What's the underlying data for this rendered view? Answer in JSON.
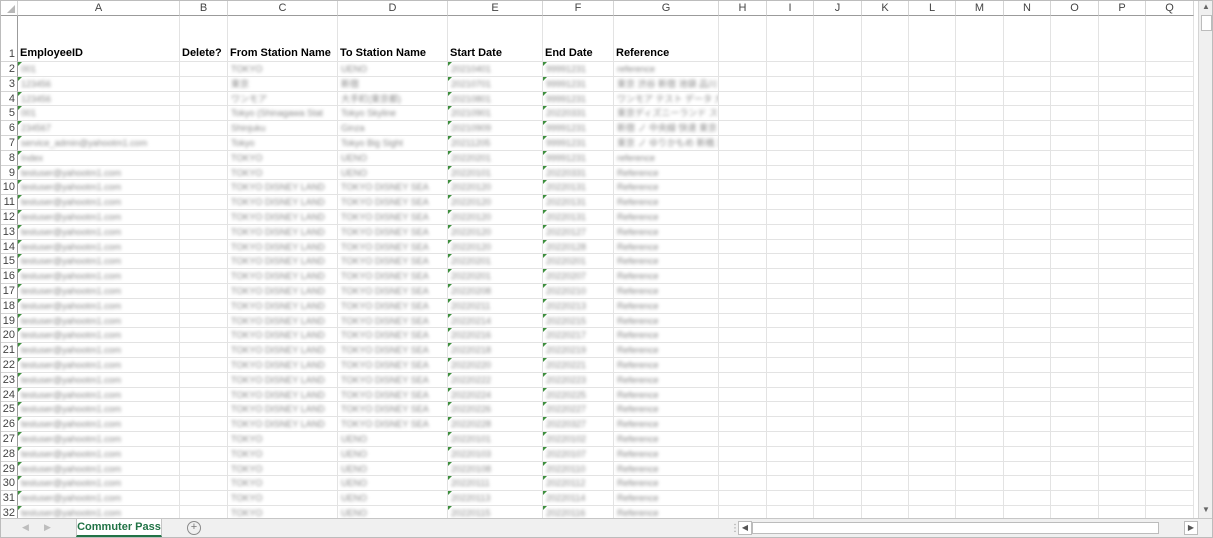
{
  "sheet": {
    "columns": [
      "A",
      "B",
      "C",
      "D",
      "E",
      "F",
      "G",
      "H",
      "I",
      "J",
      "K",
      "L",
      "M",
      "N",
      "O",
      "P",
      "Q"
    ],
    "header_row_number": "1",
    "headers": {
      "A": "EmployeeID",
      "B": "Delete?",
      "C": "From Station Name",
      "D": "To Station Name",
      "E": "Start Date",
      "F": "End Date",
      "G": "Reference"
    },
    "rows": [
      {
        "n": "2",
        "A": "001",
        "C": "TOKYO",
        "D": "UENO",
        "E": "20210401",
        "F": "99991231",
        "G": "reference"
      },
      {
        "n": "3",
        "A": "123456",
        "C": "東京",
        "D": "新宿",
        "E": "20210701",
        "F": "99991231",
        "G": "東京 渋谷 新宿 池袋 品川 目黒 恵比寿 五反田 大崎 浜松町 田町 高輪ゲートウェイ"
      },
      {
        "n": "4",
        "A": "123456",
        "C": "ワンモア",
        "D": "大手町(東京都)",
        "E": "20210801",
        "F": "99991231",
        "G": "ワンモア テスト データ 大手町 東京都 千代田区 丸の内 一丁目"
      },
      {
        "n": "5",
        "A": "001",
        "C": "Tokyo (Shinagawa Stat",
        "D": "Tokyo Skyline",
        "E": "20210901",
        "F": "20220331",
        "G": "東京ディズニーランド ステーション ディズニーシー ステーション リゾートゲートウェイ"
      },
      {
        "n": "6",
        "A": "234567",
        "C": "Shinjuku",
        "D": "Ginza",
        "E": "20210909",
        "F": "99991231",
        "G": "新宿 ノ  中央線 快速 東京 神田 御茶ノ水 四ツ谷 銀座線"
      },
      {
        "n": "7",
        "A": "service_admin@yahootm1.com",
        "C": "Tokyo",
        "D": "Tokyo Big Sight",
        "E": "20211205",
        "F": "99991231",
        "G": "東京 ノ  ゆりかもめ 新橋 汐留 竹芝 日の出 芝浦ふ頭 お台場海浜公園 台場 東京ビッグサイト"
      },
      {
        "n": "8",
        "A": "Index",
        "C": "TOKYO",
        "D": "UENO",
        "E": "20220201",
        "F": "99991231",
        "G": "reference"
      },
      {
        "n": "9",
        "A": "testuser@yahootm1.com",
        "C": "TOKYO",
        "D": "UENO",
        "E": "20220101",
        "F": "20220331",
        "G": "Reference"
      },
      {
        "n": "10",
        "A": "testuser@yahootm1.com",
        "C": "TOKYO DISNEY LAND",
        "D": "TOKYO DISNEY SEA",
        "E": "20220120",
        "F": "20220131",
        "G": "Reference"
      },
      {
        "n": "11",
        "A": "testuser@yahootm1.com",
        "C": "TOKYO DISNEY LAND",
        "D": "TOKYO DISNEY SEA",
        "E": "20220120",
        "F": "20220131",
        "G": "Reference"
      },
      {
        "n": "12",
        "A": "testuser@yahootm1.com",
        "C": "TOKYO DISNEY LAND",
        "D": "TOKYO DISNEY SEA",
        "E": "20220120",
        "F": "20220131",
        "G": "Reference"
      },
      {
        "n": "13",
        "A": "testuser@yahootm1.com",
        "C": "TOKYO DISNEY LAND",
        "D": "TOKYO DISNEY SEA",
        "E": "20220120",
        "F": "20220127",
        "G": "Reference"
      },
      {
        "n": "14",
        "A": "testuser@yahootm1.com",
        "C": "TOKYO DISNEY LAND",
        "D": "TOKYO DISNEY SEA",
        "E": "20220120",
        "F": "20220128",
        "G": "Reference"
      },
      {
        "n": "15",
        "A": "testuser@yahootm1.com",
        "C": "TOKYO DISNEY LAND",
        "D": "TOKYO DISNEY SEA",
        "E": "20220201",
        "F": "20220201",
        "G": "Reference"
      },
      {
        "n": "16",
        "A": "testuser@yahootm1.com",
        "C": "TOKYO DISNEY LAND",
        "D": "TOKYO DISNEY SEA",
        "E": "20220201",
        "F": "20220207",
        "G": "Reference"
      },
      {
        "n": "17",
        "A": "testuser@yahootm1.com",
        "C": "TOKYO DISNEY LAND",
        "D": "TOKYO DISNEY SEA",
        "E": "20220208",
        "F": "20220210",
        "G": "Reference"
      },
      {
        "n": "18",
        "A": "testuser@yahootm1.com",
        "C": "TOKYO DISNEY LAND",
        "D": "TOKYO DISNEY SEA",
        "E": "20220211",
        "F": "20220213",
        "G": "Reference"
      },
      {
        "n": "19",
        "A": "testuser@yahootm1.com",
        "C": "TOKYO DISNEY LAND",
        "D": "TOKYO DISNEY SEA",
        "E": "20220214",
        "F": "20220215",
        "G": "Reference"
      },
      {
        "n": "20",
        "A": "testuser@yahootm1.com",
        "C": "TOKYO DISNEY LAND",
        "D": "TOKYO DISNEY SEA",
        "E": "20220216",
        "F": "20220217",
        "G": "Reference"
      },
      {
        "n": "21",
        "A": "testuser@yahootm1.com",
        "C": "TOKYO DISNEY LAND",
        "D": "TOKYO DISNEY SEA",
        "E": "20220218",
        "F": "20220219",
        "G": "Reference"
      },
      {
        "n": "22",
        "A": "testuser@yahootm1.com",
        "C": "TOKYO DISNEY LAND",
        "D": "TOKYO DISNEY SEA",
        "E": "20220220",
        "F": "20220221",
        "G": "Reference"
      },
      {
        "n": "23",
        "A": "testuser@yahootm1.com",
        "C": "TOKYO DISNEY LAND",
        "D": "TOKYO DISNEY SEA",
        "E": "20220222",
        "F": "20220223",
        "G": "Reference"
      },
      {
        "n": "24",
        "A": "testuser@yahootm1.com",
        "C": "TOKYO DISNEY LAND",
        "D": "TOKYO DISNEY SEA",
        "E": "20220224",
        "F": "20220225",
        "G": "Reference"
      },
      {
        "n": "25",
        "A": "testuser@yahootm1.com",
        "C": "TOKYO DISNEY LAND",
        "D": "TOKYO DISNEY SEA",
        "E": "20220226",
        "F": "20220227",
        "G": "Reference"
      },
      {
        "n": "26",
        "A": "testuser@yahootm1.com",
        "C": "TOKYO DISNEY LAND",
        "D": "TOKYO DISNEY SEA",
        "E": "20220228",
        "F": "20220327",
        "G": "Reference"
      },
      {
        "n": "27",
        "A": "testuser@yahootm1.com",
        "C": "TOKYO",
        "D": "UENO",
        "E": "20220101",
        "F": "20220102",
        "G": "Reference"
      },
      {
        "n": "28",
        "A": "testuser@yahootm1.com",
        "C": "TOKYO",
        "D": "UENO",
        "E": "20220103",
        "F": "20220107",
        "G": "Reference"
      },
      {
        "n": "29",
        "A": "testuser@yahootm1.com",
        "C": "TOKYO",
        "D": "UENO",
        "E": "20220108",
        "F": "20220110",
        "G": "Reference"
      },
      {
        "n": "30",
        "A": "testuser@yahootm1.com",
        "C": "TOKYO",
        "D": "UENO",
        "E": "20220111",
        "F": "20220112",
        "G": "Reference"
      },
      {
        "n": "31",
        "A": "testuser@yahootm1.com",
        "C": "TOKYO",
        "D": "UENO",
        "E": "20220113",
        "F": "20220114",
        "G": "Reference"
      },
      {
        "n": "32",
        "A": "testuser@yahootm1.com",
        "C": "TOKYO",
        "D": "UENO",
        "E": "20220115",
        "F": "20220116",
        "G": "Reference"
      }
    ]
  },
  "tabbar": {
    "sheet_tab": "Commuter Pass",
    "add_sheet_symbol": "+",
    "prev_symbol": "◀",
    "next_symbol": "▶"
  },
  "colors": {
    "accent": "#217346",
    "gridline": "#e3e3e3",
    "header_border": "#9b9b9b"
  }
}
